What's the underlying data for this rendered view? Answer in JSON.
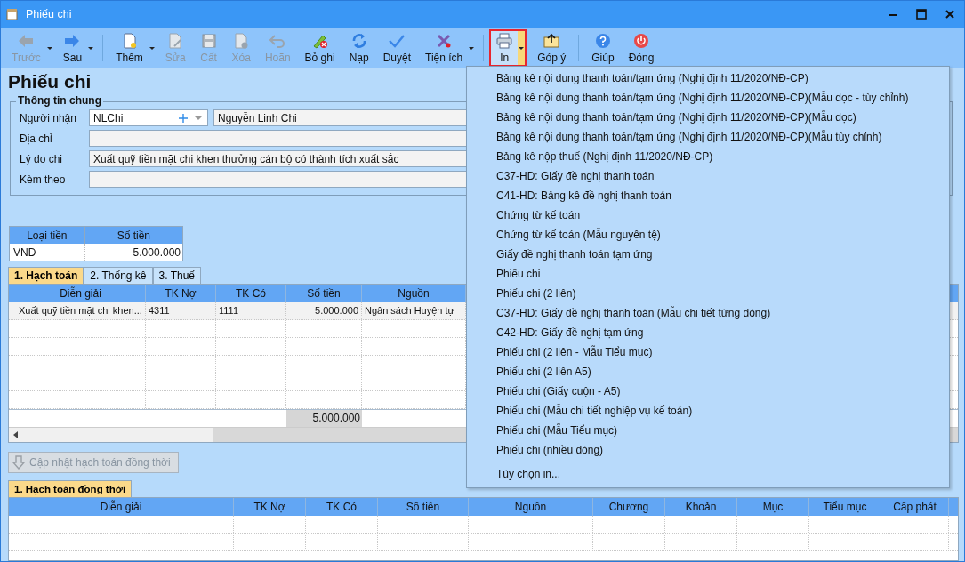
{
  "window": {
    "title": "Phiếu chi"
  },
  "toolbar": [
    {
      "label": "Trước",
      "disabled": true,
      "dropdown": true,
      "open": false
    },
    {
      "label": "Sau",
      "disabled": false,
      "dropdown": true,
      "open": false
    },
    {
      "label": "Thêm",
      "disabled": false,
      "dropdown": true,
      "open": false
    },
    {
      "label": "Sửa",
      "disabled": true,
      "dropdown": false,
      "open": false
    },
    {
      "label": "Cất",
      "disabled": true,
      "dropdown": false,
      "open": false
    },
    {
      "label": "Xóa",
      "disabled": true,
      "dropdown": false,
      "open": false
    },
    {
      "label": "Hoãn",
      "disabled": true,
      "dropdown": false,
      "open": false
    },
    {
      "label": "Bỏ ghi",
      "disabled": false,
      "dropdown": false,
      "open": false
    },
    {
      "label": "Nạp",
      "disabled": false,
      "dropdown": false,
      "open": false
    },
    {
      "label": "Duyệt",
      "disabled": false,
      "dropdown": false,
      "open": false
    },
    {
      "label": "Tiện ích",
      "disabled": false,
      "dropdown": true,
      "open": false
    },
    {
      "label": "In",
      "disabled": false,
      "dropdown": true,
      "open": true
    },
    {
      "label": "Góp ý",
      "disabled": false,
      "dropdown": false,
      "open": false
    },
    {
      "label": "Giúp",
      "disabled": false,
      "dropdown": false,
      "open": false
    },
    {
      "label": "Đóng",
      "disabled": false,
      "dropdown": false,
      "open": false
    }
  ],
  "page_title": "Phiếu chi",
  "general_info": {
    "title": "Thông tin chung",
    "fields": [
      {
        "kind": "combo",
        "label": "Người nhận",
        "value": "NLChi",
        "name_value": "Nguyễn Linh Chi"
      },
      {
        "kind": "text",
        "label": "Địa chỉ"
      },
      {
        "kind": "text",
        "label": "Lý do chi",
        "value": "Xuất quỹ tiền mặt chi khen thưởng cán bộ có thành tích xuất sắc"
      },
      {
        "kind": "text",
        "label": "Kèm theo"
      }
    ]
  },
  "currency_table": {
    "columns": [
      "Loại tiền",
      "Số tiền"
    ],
    "rows": [
      [
        "VND",
        "5.000.000"
      ]
    ]
  },
  "tabs": [
    {
      "label": "1. Hạch toán",
      "selected": true
    },
    {
      "label": "2. Thống kê",
      "selected": false
    },
    {
      "label": "3. Thuế",
      "selected": false
    }
  ],
  "entries_table": {
    "columns": [
      "Diễn giải",
      "TK Nợ",
      "TK Có",
      "Số tiền",
      "Nguồn"
    ],
    "rows": [
      [
        "Xuất quỹ tiền mặt chi khen...",
        "4311",
        "1111",
        "5.000.000",
        "Ngân sách Huyện tự"
      ]
    ],
    "total": "5.000.000"
  },
  "update_button": {
    "label": "Cập nhật hạch toán đồng thời",
    "disabled": true
  },
  "bottom_tabs": [
    {
      "label": "1. Hạch toán đồng thời",
      "selected": true
    }
  ],
  "simultaneous_table": {
    "columns": [
      "Diễn giải",
      "TK Nợ",
      "TK Có",
      "Số tiền",
      "Nguồn",
      "Chương",
      "Khoản",
      "Mục",
      "Tiểu mục",
      "Cấp phát"
    ]
  },
  "print_menu": {
    "items": [
      "Bảng kê nội dung thanh toán/tạm ứng (Nghị định 11/2020/NĐ-CP)",
      "Bảng kê nội dung thanh toán/tạm ứng (Nghị định 11/2020/NĐ-CP)(Mẫu dọc - tùy chỉnh)",
      "Bảng kê nội dung thanh toán/tạm ứng (Nghị định 11/2020/NĐ-CP)(Mẫu dọc)",
      "Bảng kê nội dung thanh toán/tạm ứng (Nghị định 11/2020/NĐ-CP)(Mẫu tùy chỉnh)",
      "Bảng kê nộp thuế (Nghị định 11/2020/NĐ-CP)",
      "C37-HD: Giấy đề nghị thanh toán",
      "C41-HD: Bảng kê đề nghị thanh toán",
      "Chứng từ kế toán",
      "Chứng từ kế toán (Mẫu nguyên tệ)",
      "Giấy đề nghị thanh toán tạm ứng",
      "Phiếu chi",
      "Phiếu chi (2 liên)",
      "C37-HD: Giấy đề nghị thanh toán (Mẫu chi tiết từng dòng)",
      "C42-HD: Giấy đề nghị tạm ứng",
      "Phiếu chi (2 liên - Mẫu Tiểu mục)",
      "Phiếu chi (2 liên A5)",
      "Phiếu chi (Giấy cuộn - A5)",
      "Phiếu chi (Mẫu chi tiết nghiệp vụ kế toán)",
      "Phiếu chi (Mẫu Tiểu mục)",
      "Phiếu chi (nhiều dòng)"
    ],
    "footer_item": "Tùy chọn in..."
  }
}
